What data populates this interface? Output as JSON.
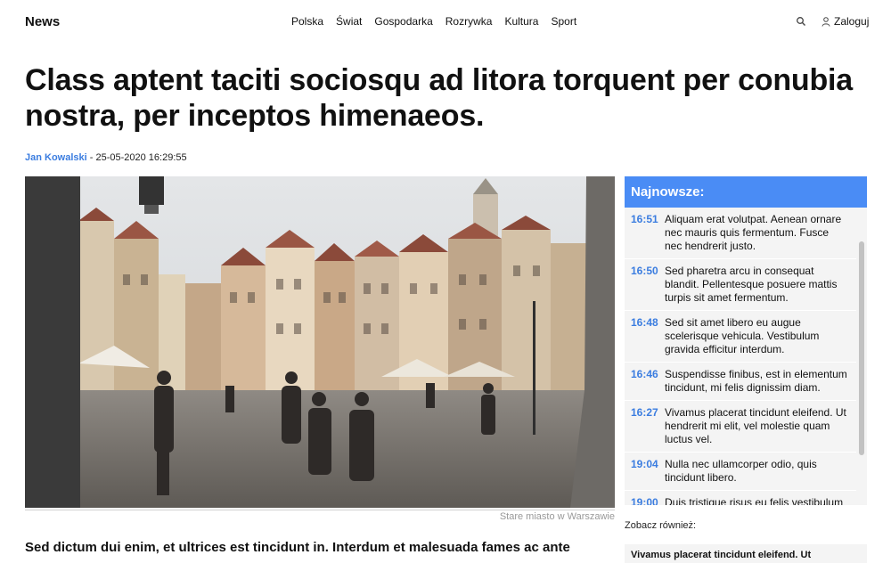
{
  "header": {
    "logo": "News",
    "nav": [
      "Polska",
      "Świat",
      "Gospodarka",
      "Rozrywka",
      "Kultura",
      "Sport"
    ],
    "login_label": "Zaloguj"
  },
  "article": {
    "title": "Class aptent taciti sociosqu ad litora torquent per conubia nostra, per inceptos himenaeos.",
    "author": "Jan Kowalski",
    "date": " - 25-05-2020 16:29:55",
    "photo_caption": "Stare miasto w Warszawie",
    "lead": "Sed dictum dui enim, et ultrices est tincidunt in. Interdum et malesuada fames ac ante"
  },
  "sidebar": {
    "title": "Najnowsze:",
    "items": [
      {
        "time": "16:51",
        "text": "Aliquam erat volutpat. Aenean ornare nec mauris quis fermentum. Fusce nec hendrerit justo."
      },
      {
        "time": "16:50",
        "text": "Sed pharetra arcu in consequat blandit. Pellentesque posuere mattis turpis sit amet fermentum."
      },
      {
        "time": "16:48",
        "text": "Sed sit amet libero eu augue scelerisque vehicula. Vestibulum gravida efficitur interdum."
      },
      {
        "time": "16:46",
        "text": "Suspendisse finibus, est in elementum tincidunt, mi felis dignissim diam."
      },
      {
        "time": "16:27",
        "text": "Vivamus placerat tincidunt eleifend. Ut hendrerit mi elit, vel molestie quam luctus vel."
      },
      {
        "time": "19:04",
        "text": "Nulla nec ullamcorper odio, quis tincidunt libero."
      },
      {
        "time": "19:00",
        "text": "Duis tristique risus eu felis vestibulum dignissim. Donec"
      }
    ],
    "see_also_label": "Zobacz również:",
    "related_title": "Vivamus placerat tincidunt eleifend. Ut"
  },
  "colors": {
    "accent": "#4a8cf5",
    "link": "#3b7de0"
  }
}
